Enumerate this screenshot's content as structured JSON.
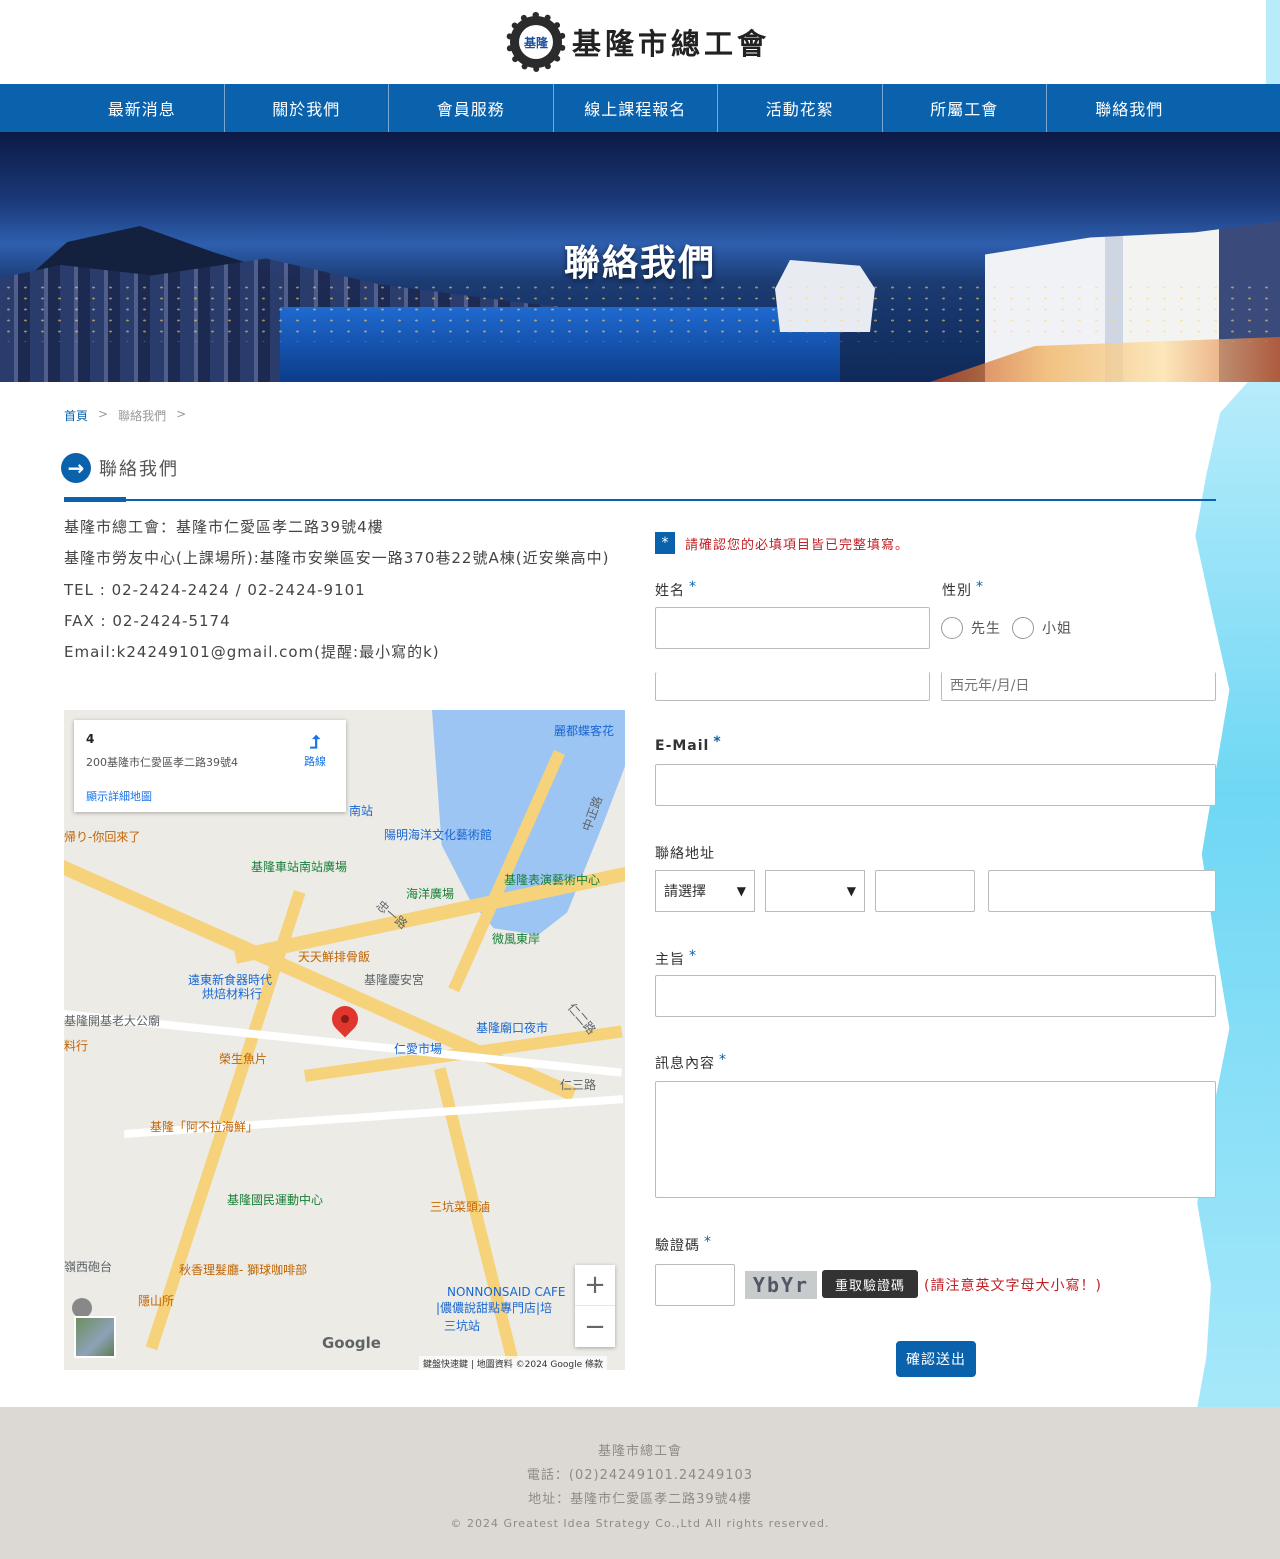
{
  "header": {
    "logo_badge": "基隆",
    "title": "基隆市總工會"
  },
  "nav": [
    {
      "label": "最新消息"
    },
    {
      "label": "關於我們"
    },
    {
      "label": "會員服務"
    },
    {
      "label": "線上課程報名"
    },
    {
      "label": "活動花絮"
    },
    {
      "label": "所屬工會"
    },
    {
      "label": "聯絡我們"
    }
  ],
  "banner": {
    "title": "聯絡我們"
  },
  "breadcrumb": {
    "home": "首頁",
    "sep1": ">",
    "current": "聯絡我們",
    "sep2": ">"
  },
  "section": {
    "title": "聯絡我們",
    "icon": "arrow-right-icon"
  },
  "info": {
    "line1": "基隆市總工會：基隆市仁愛區孝二路39號4樓",
    "line2": "基隆市勞友中心(上課場所):基隆市安樂區安一路370巷22號A棟(近安樂高中)",
    "tel": "TEL : 02-2424-2424 / 02-2424-9101",
    "fax": "FAX : 02-2424-5174",
    "email": "Email:k24249101@gmail.com(提醒:最小寫的k)"
  },
  "map": {
    "card_title": "4",
    "card_address": "200基隆市仁愛區孝二路39號4",
    "card_link": "顯示詳細地圖",
    "directions": "路線",
    "labels": {
      "l1": "麗都蝶客花",
      "l2": "南站",
      "l3": "陽明海洋文化藝術館",
      "l4": "基隆車站南站廣場",
      "l5": "海洋廣場",
      "l6": "基隆表演藝術中心",
      "l7": "微風東岸",
      "l8": "天天鮮排骨飯",
      "l9": "遠東新食器時代",
      "l10": "烘焙材料行",
      "l11": "基隆慶安宮",
      "l12": "基隆開基老大公廟",
      "l13": "料行",
      "l14": "基隆廟口夜市",
      "l15": "仁愛市場",
      "l16": "榮生魚片",
      "l17": "基隆「阿不拉海鮮」",
      "l18": "基隆國民運動中心",
      "l19": "三坑菜頭滷",
      "l20": "秋香理髮廳- 獅球咖啡部",
      "l21": "嶺西砲台",
      "l22": "隱山所",
      "l23": "NONNONSAID CAFE",
      "l24": "|儂儂說甜點專門店|培",
      "l25": "三坑站",
      "l26": "帰り-你回來了",
      "l27": "中正路",
      "l28": "忠一路",
      "l29": "仁二路",
      "l30": "仁三路"
    },
    "zoom_in": "+",
    "zoom_out": "−",
    "google": "Google",
    "attribution": "鍵盤快速鍵 | 地圖資料 ©2024 Google  條款"
  },
  "form": {
    "notice_mark": "*",
    "notice": "請確認您的必填項目皆已完整填寫。",
    "required_mark": "*",
    "name_label": "姓名",
    "gender_label": "性別",
    "gender_options": [
      "先生",
      "小姐"
    ],
    "birthday_placeholder": "西元年/月/日",
    "email_label": "E-Mail",
    "address_label": "聯絡地址",
    "city_select": "請選擇",
    "subject_label": "主旨",
    "message_label": "訊息內容",
    "captcha_label": "驗證碼",
    "captcha_text": "YbYr",
    "refresh_label": "重取驗證碼",
    "captcha_note": "(請注意英文字母大小寫！)",
    "submit_label": "確認送出"
  },
  "footer": {
    "name": "基隆市總工會",
    "phone": "電話：(02)24249101.24249103",
    "address": "地址：基隆市仁愛區孝二路39號4樓",
    "copyright": "© 2024 Greatest Idea Strategy Co.,Ltd All rights reserved."
  },
  "colors": {
    "primary": "#0a62ad",
    "alert": "#c02025",
    "footer_bg": "#dcd9d5"
  }
}
